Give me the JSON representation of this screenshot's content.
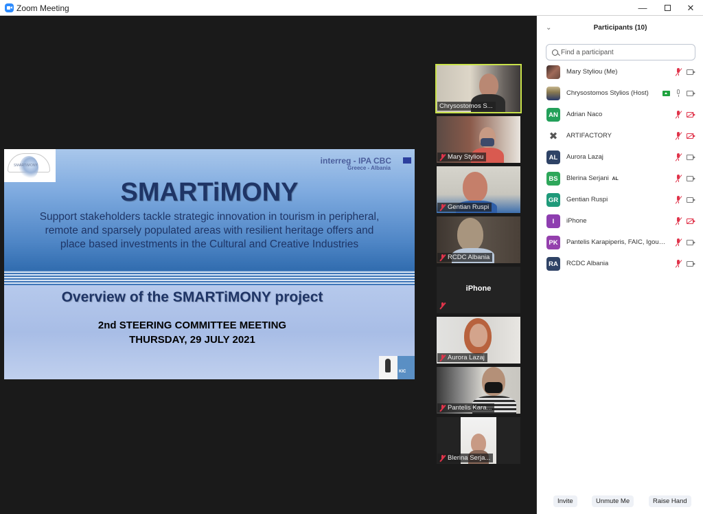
{
  "window": {
    "title": "Zoom Meeting",
    "controls": [
      "minimize",
      "maximize",
      "close"
    ]
  },
  "slide": {
    "logo_text": "SMARTiMONY",
    "program": "interreg - IPA CBC",
    "program_sub": "Greece - Albania",
    "title": "SMARTiMONY",
    "subtitle": "Support stakeholders tackle strategic innovation in tourism in peripheral, remote and sparsely populated areas with resilient heritage offers and place based investments in the Cultural and Creative Industries",
    "heading": "Overview of the SMARTiMONY project",
    "meeting_line1": "2nd STEERING COMMITTEE MEETING",
    "meeting_line2": "THURSDAY, 29 JULY 2021"
  },
  "video_tiles": [
    {
      "name": "Chrysostomos S...",
      "muted": false,
      "active_speaker": true,
      "video": true
    },
    {
      "name": "Mary Styliou",
      "muted": true,
      "active_speaker": false,
      "video": true
    },
    {
      "name": "Gentian Ruspi",
      "muted": true,
      "active_speaker": false,
      "video": true
    },
    {
      "name": "RCDC Albania",
      "muted": true,
      "active_speaker": false,
      "video": true
    },
    {
      "name": "iPhone",
      "muted": true,
      "active_speaker": false,
      "video": false
    },
    {
      "name": "Aurora Lazaj",
      "muted": true,
      "active_speaker": false,
      "video": true
    },
    {
      "name": "Pantelis Kara...",
      "muted": true,
      "active_speaker": false,
      "video": true
    },
    {
      "name": "Blerina Serja...",
      "muted": true,
      "active_speaker": false,
      "video": true
    }
  ],
  "participants_panel": {
    "title": "Participants (10)",
    "search_placeholder": "Find a participant",
    "participants": [
      {
        "name": "Mary Styliou (Me)",
        "initials": "",
        "avatar_color": "#7a4a3a",
        "photo": true,
        "muted": true,
        "video_off": false,
        "sharing": false,
        "tag": ""
      },
      {
        "name": "Chrysostomos Stylios (Host)",
        "initials": "",
        "avatar_color": "#6b6a3a",
        "photo": true,
        "muted": false,
        "video_off": false,
        "sharing": true,
        "tag": ""
      },
      {
        "name": "Adrian Naco",
        "initials": "AN",
        "avatar_color": "#23a05a",
        "photo": false,
        "muted": true,
        "video_off": true,
        "sharing": false,
        "tag": ""
      },
      {
        "name": "ARTIFACTORY",
        "initials": "",
        "avatar_color": "#ffffff",
        "photo": true,
        "muted": true,
        "video_off": true,
        "sharing": false,
        "tag": ""
      },
      {
        "name": "Aurora Lazaj",
        "initials": "AL",
        "avatar_color": "#2f4366",
        "photo": false,
        "muted": true,
        "video_off": false,
        "sharing": false,
        "tag": ""
      },
      {
        "name": "Blerina Serjani",
        "initials": "BS",
        "avatar_color": "#2ea75a",
        "photo": false,
        "muted": true,
        "video_off": false,
        "sharing": false,
        "tag": "AL"
      },
      {
        "name": "Gentian Ruspi",
        "initials": "GR",
        "avatar_color": "#1f9a7a",
        "photo": false,
        "muted": true,
        "video_off": false,
        "sharing": false,
        "tag": ""
      },
      {
        "name": "iPhone",
        "initials": "I",
        "avatar_color": "#8e3eb0",
        "photo": false,
        "muted": true,
        "video_off": true,
        "sharing": false,
        "tag": ""
      },
      {
        "name": "Pantelis Karapiperis, FAIC, Igoum...",
        "initials": "PK",
        "avatar_color": "#9440ad",
        "photo": false,
        "muted": true,
        "video_off": false,
        "sharing": false,
        "tag": ""
      },
      {
        "name": "RCDC Albania",
        "initials": "RA",
        "avatar_color": "#2f4366",
        "photo": false,
        "muted": true,
        "video_off": false,
        "sharing": false,
        "tag": ""
      }
    ],
    "footer_buttons": [
      "Invite",
      "Unmute Me",
      "Raise Hand"
    ]
  }
}
